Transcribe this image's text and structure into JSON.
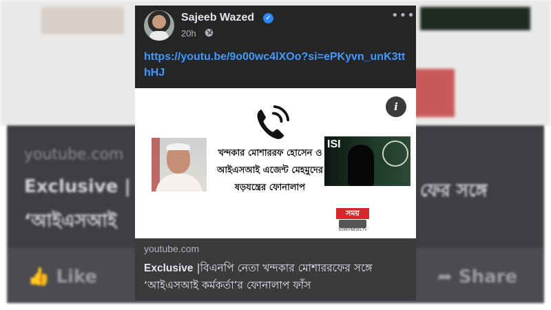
{
  "post": {
    "author": "Sajeeb Wazed",
    "time": "20h",
    "link_text": "https://youtu.be/9o00wc4lXOo?si=ePKyvn_unK3tthHJ"
  },
  "preview": {
    "thumbnail_text": "খন্দকার মোশাররফ হোসেন ও আইএসআই এজেন্ট মেহমুদের ষড়যন্ত্রের ফোনালাপ",
    "right_image_label": "ISI",
    "logo_text": "সময়",
    "logo_subtext": "SOMOYNEWS.TV"
  },
  "link_card": {
    "domain": "youtube.com",
    "title_bold": "Exclusive",
    "title_rest": " |বিএনপি নেতা খন্দকার মোশাররফের সঙ্গে ‘আইএসআই কর্মকর্তা’র ফোনালাপ ফাঁস"
  },
  "background": {
    "domain": "youtube.com",
    "headline_start": "Exclusive |",
    "headline_end": "ফের সঙ্গে",
    "headline_line2": "‘আইএসআই",
    "like_label": "Like",
    "share_label": "Share"
  },
  "icons": {
    "verified": "verified-badge-icon",
    "globe": "globe-icon",
    "more": "more-options-icon",
    "phone": "phone-call-icon",
    "info": "info-icon"
  },
  "colors": {
    "card_bg": "#242526",
    "link": "#4599ff",
    "verified": "#2d88ff",
    "meta_bg": "#3a3b3c"
  }
}
